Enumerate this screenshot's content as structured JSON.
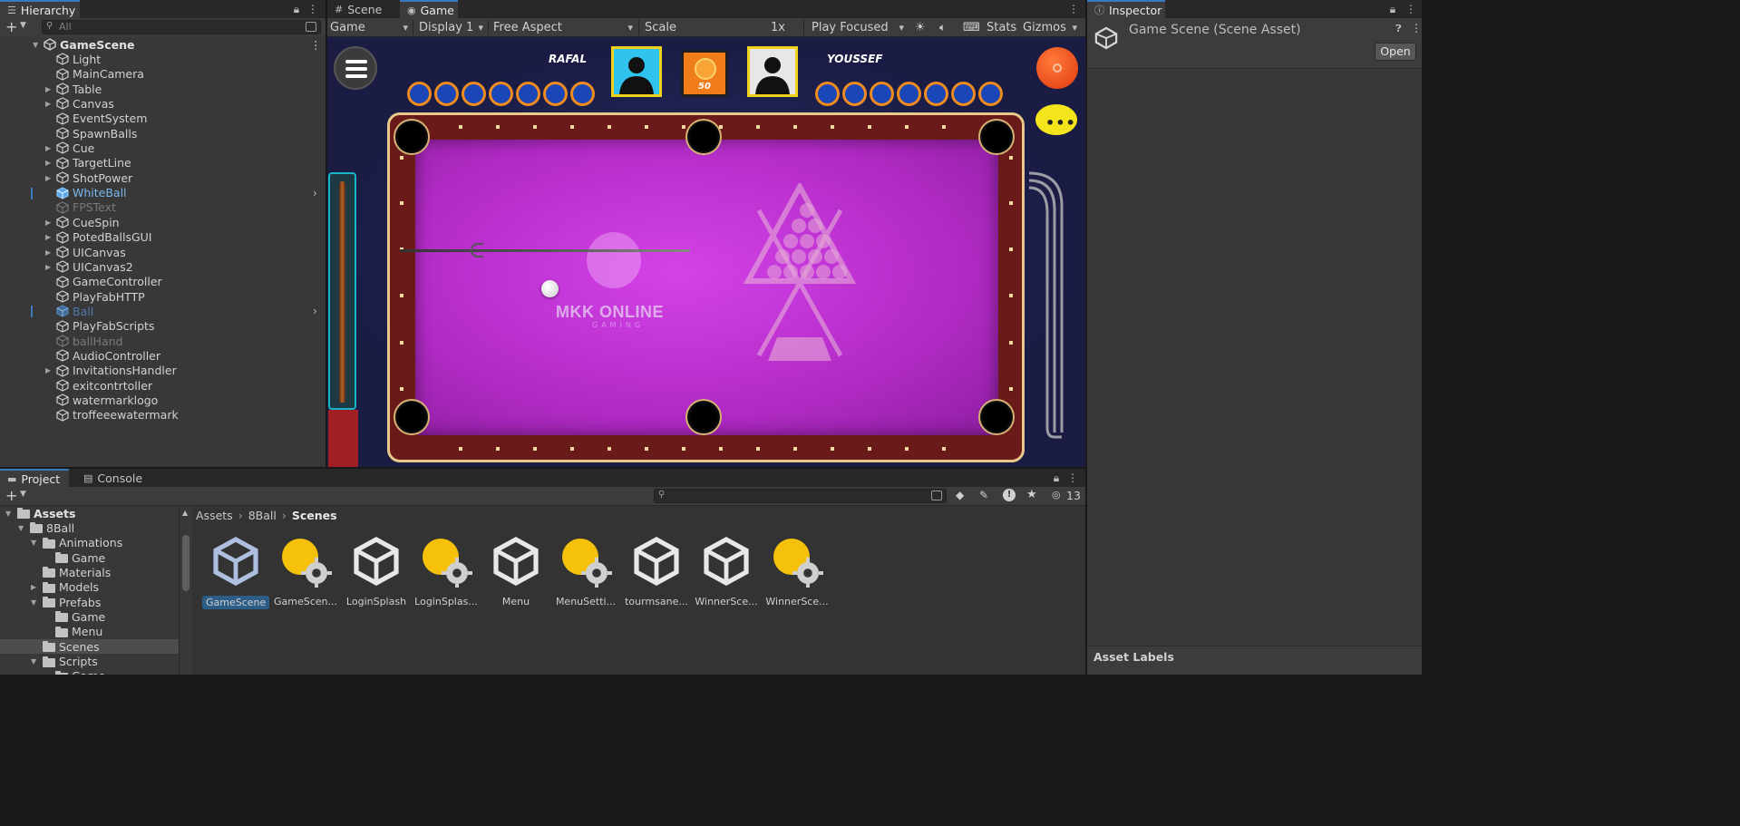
{
  "hierarchy": {
    "tab_label": "Hierarchy",
    "search_placeholder": "All",
    "scene_name": "GameScene",
    "items": [
      {
        "label": "Light",
        "expand": false,
        "state": "normal"
      },
      {
        "label": "MainCamera",
        "expand": false,
        "state": "normal"
      },
      {
        "label": "Table",
        "expand": true,
        "state": "normal"
      },
      {
        "label": "Canvas",
        "expand": true,
        "state": "normal"
      },
      {
        "label": "EventSystem",
        "expand": false,
        "state": "normal"
      },
      {
        "label": "SpawnBalls",
        "expand": false,
        "state": "normal"
      },
      {
        "label": "Cue",
        "expand": true,
        "state": "normal"
      },
      {
        "label": "TargetLine",
        "expand": true,
        "state": "normal"
      },
      {
        "label": "ShotPower",
        "expand": true,
        "state": "normal"
      },
      {
        "label": "WhiteBall",
        "expand": false,
        "state": "prefab"
      },
      {
        "label": "FPSText",
        "expand": false,
        "state": "disabled"
      },
      {
        "label": "CueSpin",
        "expand": true,
        "state": "normal"
      },
      {
        "label": "PotedBallsGUI",
        "expand": true,
        "state": "normal"
      },
      {
        "label": "UICanvas",
        "expand": true,
        "state": "normal"
      },
      {
        "label": "UICanvas2",
        "expand": true,
        "state": "normal"
      },
      {
        "label": "GameController",
        "expand": false,
        "state": "normal"
      },
      {
        "label": "PlayFabHTTP",
        "expand": false,
        "state": "normal"
      },
      {
        "label": "Ball",
        "expand": false,
        "state": "prefab-disabled"
      },
      {
        "label": "PlayFabScripts",
        "expand": false,
        "state": "normal"
      },
      {
        "label": "ballHand",
        "expand": false,
        "state": "disabled"
      },
      {
        "label": "AudioController",
        "expand": false,
        "state": "normal"
      },
      {
        "label": "InvitationsHandler",
        "expand": true,
        "state": "normal"
      },
      {
        "label": "exitcontrtoller",
        "expand": false,
        "state": "normal"
      },
      {
        "label": "watermarklogo",
        "expand": false,
        "state": "normal"
      },
      {
        "label": "troffeeewatermark",
        "expand": false,
        "state": "normal"
      }
    ]
  },
  "game_view": {
    "tabs": [
      {
        "label": "Scene"
      },
      {
        "label": "Game"
      }
    ],
    "toolbar": {
      "mode": "Game",
      "display": "Display 1",
      "aspect": "Free Aspect",
      "scale_label": "Scale",
      "scale_value": "1x",
      "play_mode": "Play Focused",
      "stats": "Stats",
      "gizmos": "Gizmos"
    },
    "game": {
      "player1": "RAFAL",
      "player2": "YOUSSEF",
      "stake": "50",
      "watermark": "MKK ONLINE",
      "watermark_sub": "GAMING",
      "colors": {
        "table_felt": "#c12fd6",
        "rail": "#6b1a1a",
        "background": "#1c1f4a"
      }
    }
  },
  "inspector": {
    "tab_label": "Inspector",
    "title": "Game Scene (Scene Asset)",
    "open_button": "Open",
    "asset_labels": "Asset Labels"
  },
  "project": {
    "tabs": [
      {
        "label": "Project"
      },
      {
        "label": "Console"
      }
    ],
    "hidden_count": "13",
    "breadcrumb": [
      "Assets",
      "8Ball",
      "Scenes"
    ],
    "tree": [
      {
        "label": "Assets",
        "depth": 0,
        "open": true,
        "bold": true
      },
      {
        "label": "8Ball",
        "depth": 1,
        "open": true
      },
      {
        "label": "Animations",
        "depth": 2,
        "open": true
      },
      {
        "label": "Game",
        "depth": 3,
        "open": null
      },
      {
        "label": "Materials",
        "depth": 2,
        "open": null
      },
      {
        "label": "Models",
        "depth": 2,
        "open": false
      },
      {
        "label": "Prefabs",
        "depth": 2,
        "open": true
      },
      {
        "label": "Game",
        "depth": 3,
        "open": null
      },
      {
        "label": "Menu",
        "depth": 3,
        "open": null
      },
      {
        "label": "Scenes",
        "depth": 2,
        "open": null,
        "selected": true
      },
      {
        "label": "Scripts",
        "depth": 2,
        "open": true
      },
      {
        "label": "Game",
        "depth": 3,
        "open": null
      }
    ],
    "assets": [
      {
        "label": "GameScene",
        "type": "scene",
        "selected": true
      },
      {
        "label": "GameScen...",
        "type": "lighting"
      },
      {
        "label": "LoginSplash",
        "type": "scene"
      },
      {
        "label": "LoginSplas...",
        "type": "lighting"
      },
      {
        "label": "Menu",
        "type": "scene"
      },
      {
        "label": "MenuSetti...",
        "type": "lighting"
      },
      {
        "label": "tourmsane...",
        "type": "scene"
      },
      {
        "label": "WinnerSce...",
        "type": "scene"
      },
      {
        "label": "WinnerSce...",
        "type": "lighting"
      }
    ]
  }
}
